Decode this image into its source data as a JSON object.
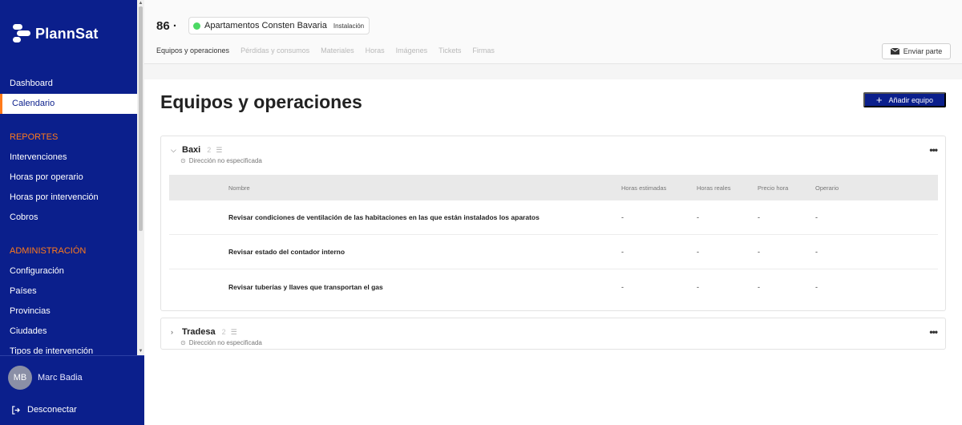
{
  "app": {
    "name": "PlannSat"
  },
  "sidebar": {
    "items_top": [
      {
        "label": "Dashboard"
      },
      {
        "label": "Calendario",
        "active": true
      }
    ],
    "section_reportes": "REPORTES",
    "items_reportes": [
      {
        "label": "Intervenciones"
      },
      {
        "label": "Horas por operario"
      },
      {
        "label": "Horas por intervención"
      },
      {
        "label": "Cobros"
      }
    ],
    "section_admin": "ADMINISTRACIÓN",
    "items_admin": [
      {
        "label": "Configuración"
      },
      {
        "label": "Países"
      },
      {
        "label": "Provincias"
      },
      {
        "label": "Ciudades"
      },
      {
        "label": "Tipos de intervención"
      }
    ],
    "user": {
      "initials": "MB",
      "name": "Marc Badia"
    },
    "logout_label": "Desconectar"
  },
  "header": {
    "ticket_number": "86 ·",
    "site_name": "Apartamentos Consten Bavaria",
    "site_type": "Instalación",
    "status_color": "#4cd964",
    "tabs": [
      {
        "label": "Equipos y operaciones",
        "active": true
      },
      {
        "label": "Pérdidas y consumos"
      },
      {
        "label": "Materiales"
      },
      {
        "label": "Horas"
      },
      {
        "label": "Imágenes"
      },
      {
        "label": "Tickets"
      },
      {
        "label": "Firmas"
      }
    ],
    "send_label": "Enviar parte"
  },
  "main": {
    "title": "Equipos y operaciones",
    "add_label": "Añadir equipo",
    "columns": [
      "Nombre",
      "Horas estimadas",
      "Horas reales",
      "Precio hora",
      "Operario"
    ],
    "equipment": [
      {
        "name": "Baxi",
        "count": "2",
        "address": "Dirección no especificada",
        "expanded": true,
        "operations": [
          {
            "enabled": true,
            "name": "Revisar condiciones de ventilación de las habitaciones en las que están instalados los aparatos",
            "est": "-",
            "real": "-",
            "price": "-",
            "operator": "-"
          },
          {
            "enabled": true,
            "name": "Revisar estado del contador interno",
            "est": "-",
            "real": "-",
            "price": "-",
            "operator": "-"
          },
          {
            "enabled": false,
            "name": "Revisar tuberías y llaves que transportan el gas",
            "est": "-",
            "real": "-",
            "price": "-",
            "operator": "-"
          }
        ]
      },
      {
        "name": "Tradesa",
        "count": "2",
        "address": "Dirección no especificada",
        "expanded": false
      }
    ]
  },
  "colors": {
    "brand": "#0b1f8c",
    "accent": "#ff7a1a"
  }
}
